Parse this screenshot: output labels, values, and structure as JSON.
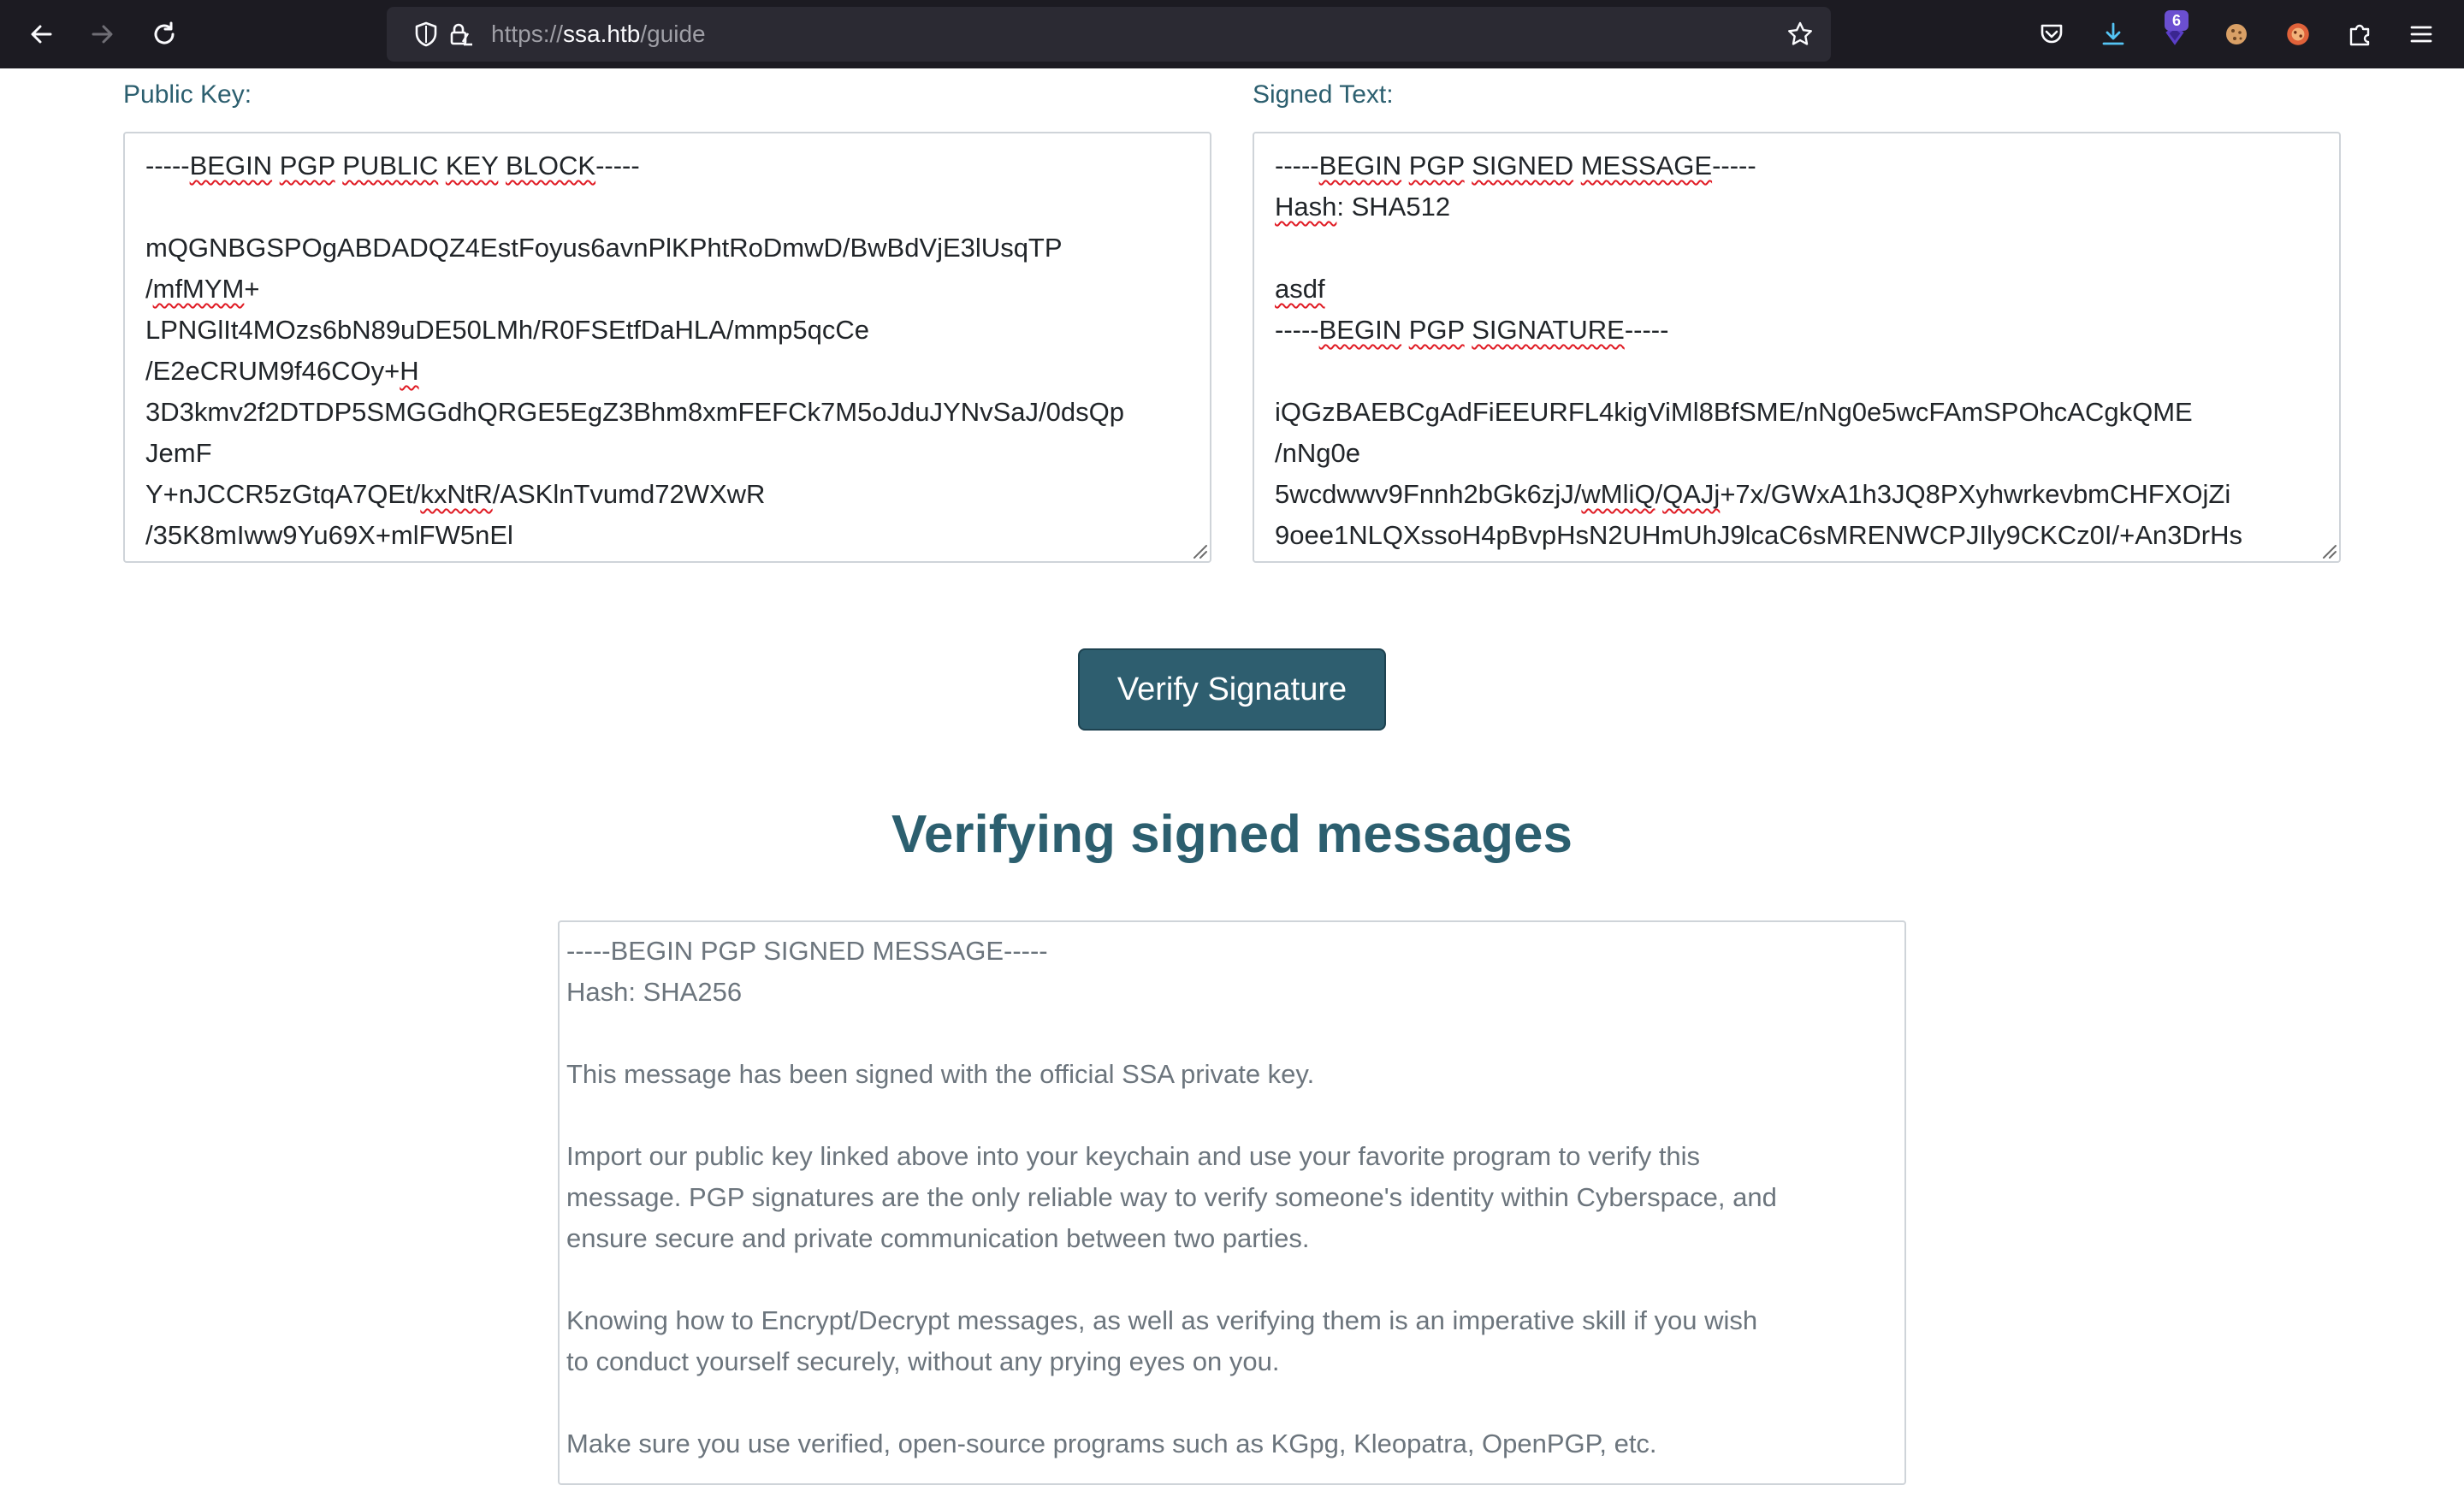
{
  "browser": {
    "url_scheme": "https://",
    "url_host": "ssa.htb",
    "url_path": "/guide",
    "extension_badge": "6"
  },
  "public_key": {
    "label": "Public Key:",
    "lines": [
      "-----BEGIN PGP PUBLIC KEY BLOCK-----",
      "",
      "mQGNBGSPOgABDADQZ4EstFoyus6avnPlKPhtRoDmwD/BwBdVjE3lUsqTP",
      "/mfMYM+",
      "LPNGlIt4MOzs6bN89uDE50LMh/R0FSEtfDaHLA/mmp5qcCe",
      "/E2eCRUM9f46COy+H",
      "3D3kmv2f2DTDP5SMGGdhQRGE5EgZ3Bhm8xmFEFCk7M5oJduJYNvSaJ/0dsQp",
      "JemF",
      "Y+nJCCR5zGtqA7QEt/kxNtR/ASKlnTvumd72WXwR",
      "/35K8mIww9Yu69X+mlFW5nEl"
    ]
  },
  "signed_text": {
    "label": "Signed Text:",
    "lines": [
      "-----BEGIN PGP SIGNED MESSAGE-----",
      "Hash: SHA512",
      "",
      "asdf",
      "-----BEGIN PGP SIGNATURE-----",
      "",
      "iQGzBAEBCgAdFiEEURFL4kigViMl8BfSME/nNg0e5wcFAmSPOhcACgkQME",
      "/nNg0e",
      "5wcdwwv9Fnnh2bGk6zjJ/wMliQ/QAJj+7x/GWxA1h3JQ8PXyhwrkevbmCHFXOjZi",
      "9oee1NLQXssoH4pBvpHsN2UHmUhJ9lcaC6sMRENWCPJIly9CKCz0I/+An3DrHs"
    ]
  },
  "verify_button": "Verify Signature",
  "section_heading": "Verifying signed messages",
  "example_message": {
    "lines": [
      "-----BEGIN PGP SIGNED MESSAGE-----",
      "Hash: SHA256",
      "",
      "This message has been signed with the official SSA private key.",
      "",
      "Import our public key linked above into your keychain and use your favorite program to verify this",
      "message. PGP signatures are the only reliable way to verify someone's identity within Cyberspace, and",
      "ensure secure and private communication between two parties.",
      "",
      "Knowing how to Encrypt/Decrypt messages, as well as verifying them is an imperative skill if you wish",
      "to conduct yourself securely, without any prying eyes on you.",
      "",
      "Make sure you use verified, open-source programs such as KGpg, Kleopatra, OpenPGP, etc."
    ]
  }
}
